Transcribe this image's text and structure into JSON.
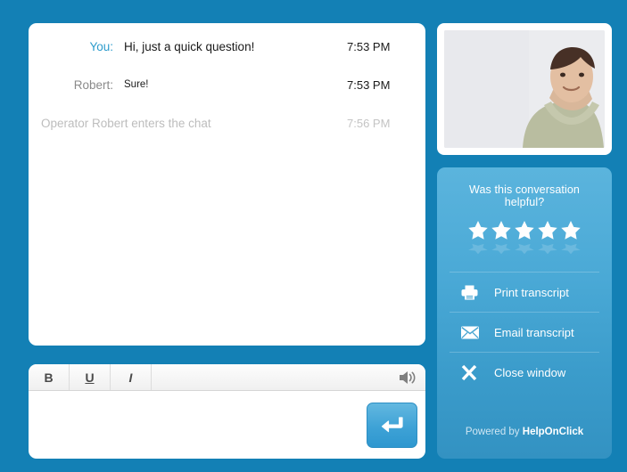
{
  "transcript": {
    "messages": [
      {
        "author": "You:",
        "type": "you",
        "text": "Hi, just a quick question!",
        "time": "7:53 PM"
      },
      {
        "author": "Robert:",
        "type": "agent",
        "text": "Sure!",
        "time": "7:53 PM"
      },
      {
        "author": "",
        "type": "system",
        "text": "Operator Robert enters the chat",
        "time": "7:56 PM"
      }
    ]
  },
  "composer": {
    "bold_label": "B",
    "underline_label": "U",
    "italic_label": "I",
    "sound_icon": "speaker-icon",
    "input_value": "",
    "input_placeholder": "",
    "send_icon": "enter-arrow-icon"
  },
  "operator": {
    "photo_alt": "operator-photo"
  },
  "rating": {
    "question": "Was this conversation helpful?",
    "stars": 5,
    "actions": [
      {
        "icon": "printer-icon",
        "label": "Print transcript"
      },
      {
        "icon": "envelope-icon",
        "label": "Email transcript"
      },
      {
        "icon": "close-x-icon",
        "label": "Close window"
      }
    ]
  },
  "footer": {
    "powered_prefix": "Powered by ",
    "brand": "HelpOnClick"
  },
  "colors": {
    "background": "#1380b5",
    "you_label": "#2e9ccc",
    "agent_label": "#8a8a8a",
    "system_text": "#bdbdbd",
    "panel_gradient_top": "#5bb4dd",
    "panel_gradient_bottom": "#3392c2",
    "send_button": "#3ea2d6"
  }
}
